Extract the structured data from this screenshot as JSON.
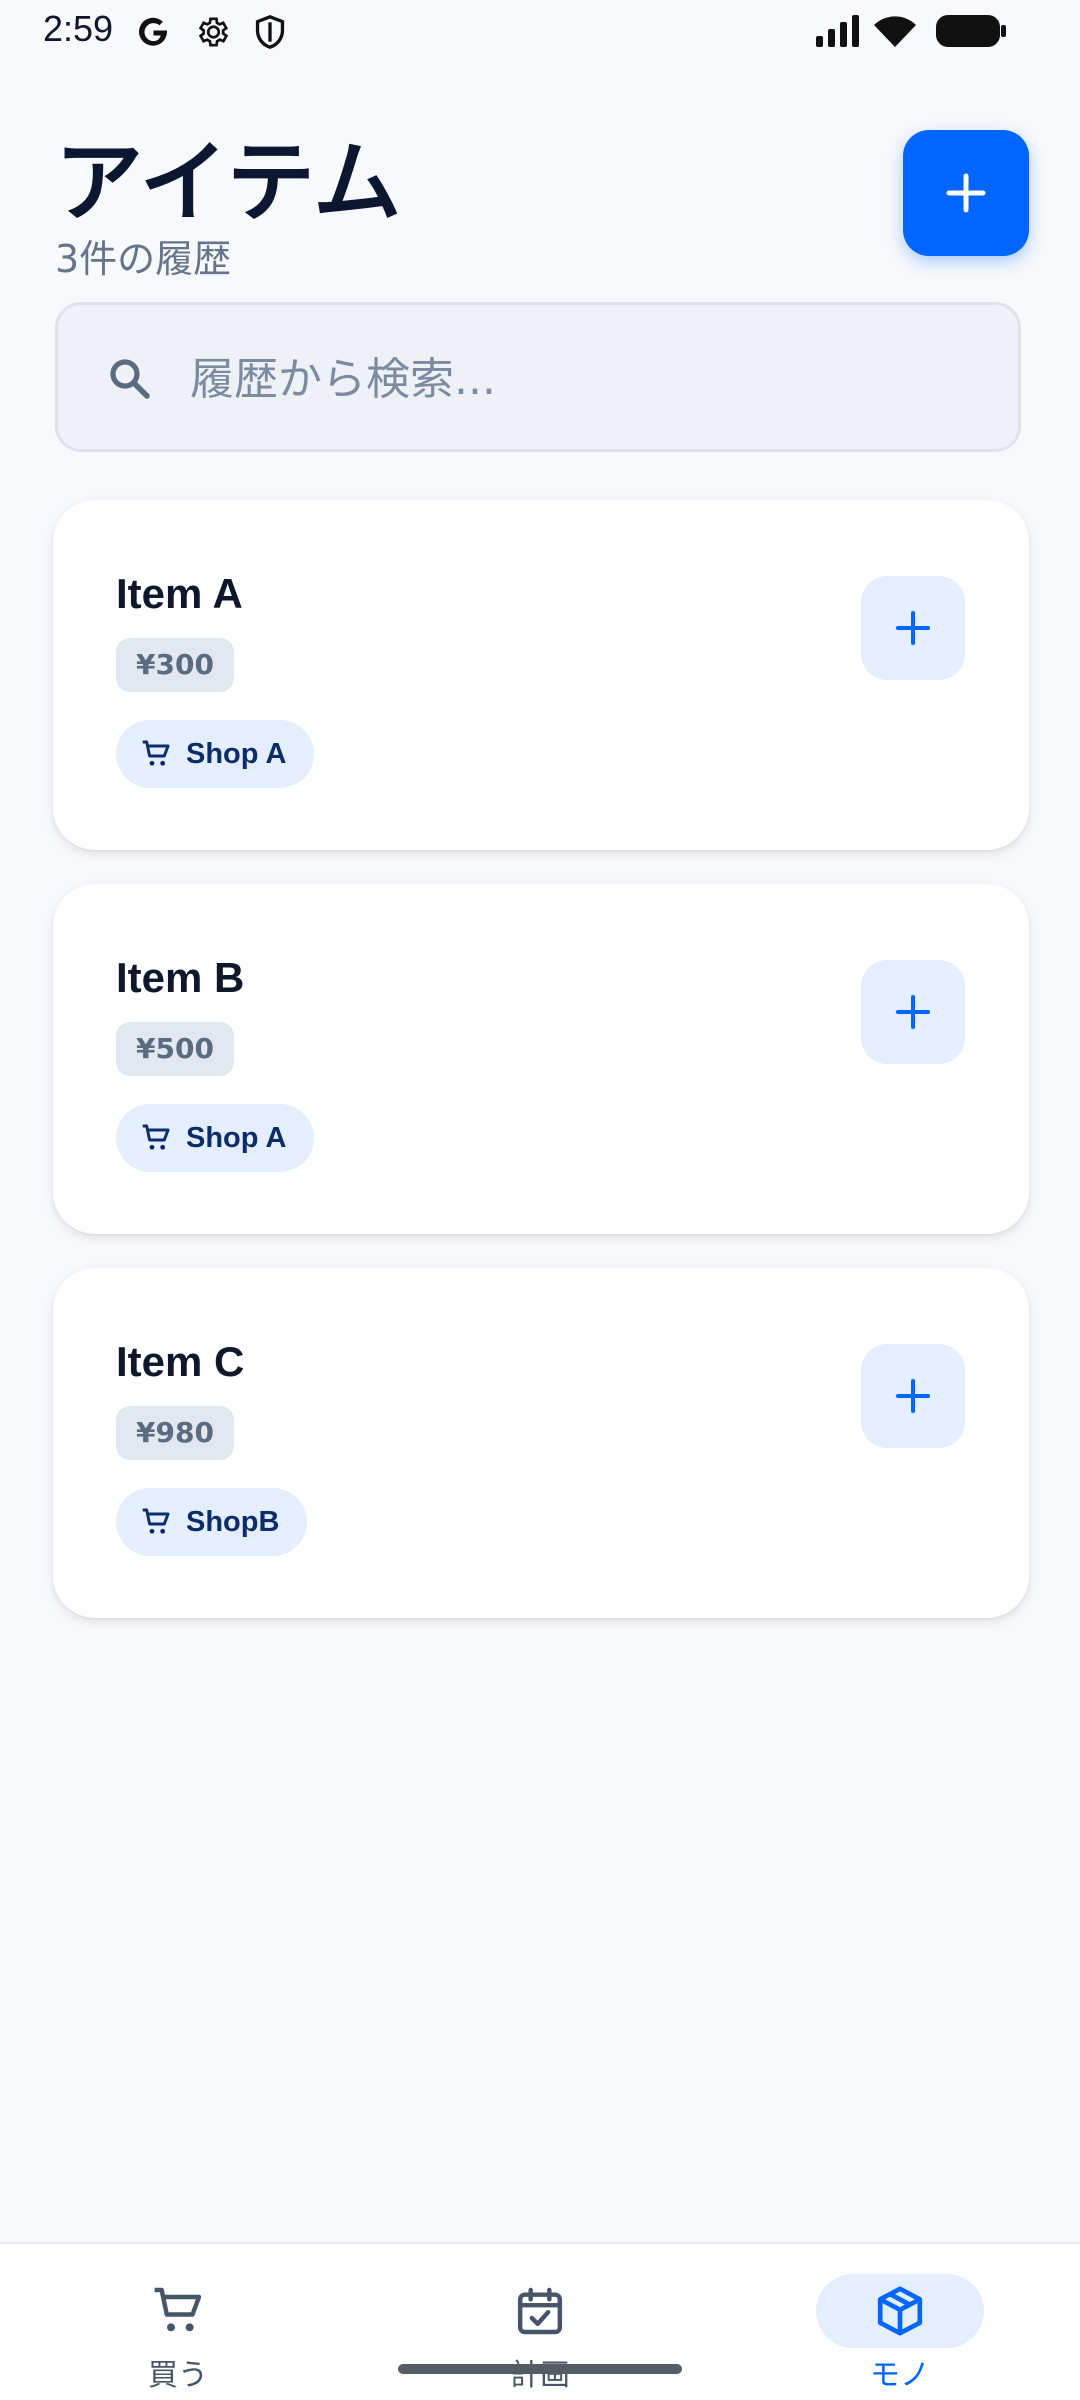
{
  "status_bar": {
    "time": "2:59",
    "left_icons": [
      "google-icon",
      "gear-icon",
      "shield-icon"
    ],
    "right_icons": [
      "signal-icon",
      "wifi-icon",
      "battery-icon"
    ]
  },
  "header": {
    "title": "アイテム",
    "subtitle": "3件の履歴",
    "add_button_icon": "plus-icon"
  },
  "search": {
    "placeholder": "履歴から検索...",
    "value": ""
  },
  "items": [
    {
      "name": "Item A",
      "price": "¥300",
      "shop": "Shop A"
    },
    {
      "name": "Item B",
      "price": "¥500",
      "shop": "Shop A"
    },
    {
      "name": "Item C",
      "price": "¥980",
      "shop": "ShopB"
    }
  ],
  "bottom_nav": {
    "items": [
      {
        "label": "買う",
        "icon": "cart-icon",
        "active": false
      },
      {
        "label": "計画",
        "icon": "calendar-check-icon",
        "active": false
      },
      {
        "label": "モノ",
        "icon": "box-icon",
        "active": true
      }
    ]
  },
  "colors": {
    "accent": "#0066FF",
    "background": "#F7F9FC",
    "card": "#FFFFFF",
    "chip_bg": "#E4EEFD",
    "title_text": "#0B1730"
  }
}
